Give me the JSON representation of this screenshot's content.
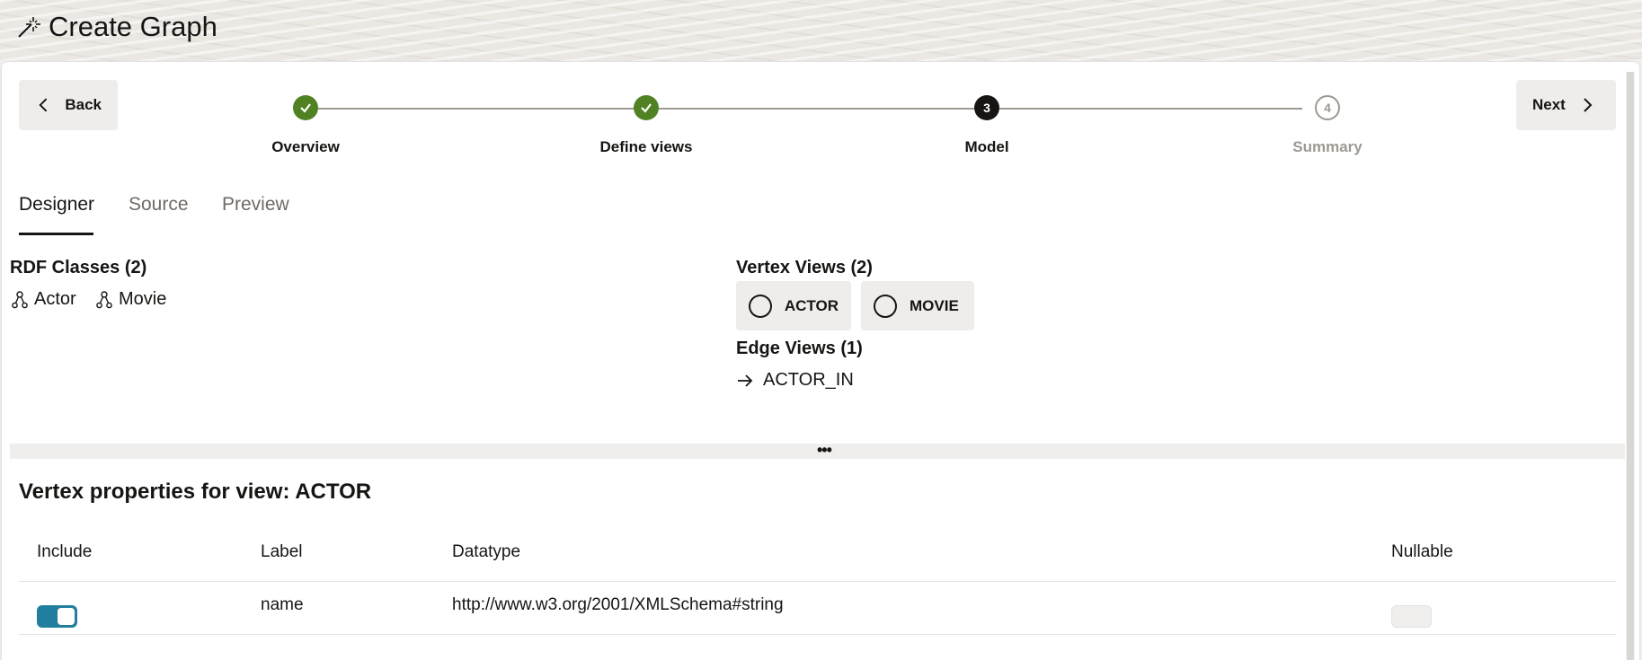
{
  "header": {
    "title": "Create Graph",
    "icon": "magic-wand-icon"
  },
  "nav": {
    "back_label": "Back",
    "next_label": "Next"
  },
  "stepper": {
    "steps": [
      {
        "label": "Overview",
        "state": "done"
      },
      {
        "label": "Define views",
        "state": "done"
      },
      {
        "label": "Model",
        "state": "current",
        "number": "3"
      },
      {
        "label": "Summary",
        "state": "future",
        "number": "4"
      }
    ]
  },
  "tabs": [
    {
      "label": "Designer",
      "active": true
    },
    {
      "label": "Source",
      "active": false
    },
    {
      "label": "Preview",
      "active": false
    }
  ],
  "rdf_classes": {
    "title": "RDF Classes (2)",
    "items": [
      "Actor",
      "Movie"
    ]
  },
  "vertex_views": {
    "title": "Vertex Views (2)",
    "items": [
      "ACTOR",
      "MOVIE"
    ]
  },
  "edge_views": {
    "title": "Edge Views (1)",
    "items": [
      "ACTOR_IN"
    ]
  },
  "splitter": {
    "label": "•••"
  },
  "vertex_properties": {
    "title": "Vertex properties for view: ACTOR",
    "columns": [
      "Include",
      "Label",
      "Datatype",
      "Nullable"
    ],
    "rows": [
      {
        "include": true,
        "label": "name",
        "datatype": "http://www.w3.org/2001/XMLSchema#string",
        "nullable": false
      }
    ]
  },
  "colors": {
    "accent": "#227e9e",
    "done": "#508223",
    "text": "#161513"
  }
}
